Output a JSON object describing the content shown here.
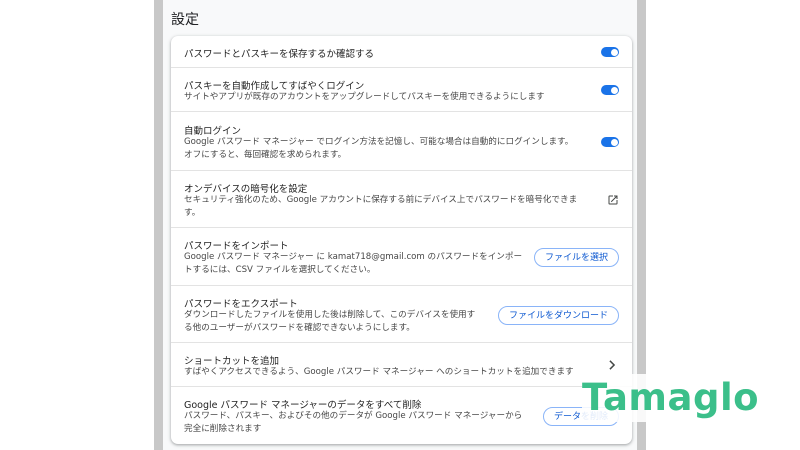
{
  "section": {
    "title": "設定"
  },
  "colors": {
    "accent": "#1a73e8",
    "brand": "#3bbf8a"
  },
  "rows": [
    {
      "title": "パスワードとパスキーを保存するか確認する",
      "control": "toggle",
      "on": true
    },
    {
      "title": "パスキーを自動作成してすばやくログイン",
      "desc": "サイトやアプリが既存のアカウントをアップグレードしてパスキーを使用できるようにします",
      "control": "toggle",
      "on": true
    },
    {
      "title": "自動ログイン",
      "desc1": "Google パスワード マネージャー でログイン方法を記憶し、可能な場合は自動的にログインします。",
      "desc2": "オフにすると、毎回確認を求められます。",
      "control": "toggle",
      "on": true
    },
    {
      "title": "オンデバイスの暗号化を設定",
      "desc1": "セキュリティ強化のため、Google アカウントに保存する前にデバイス上でパスワードを暗号化できま",
      "desc2": "す。",
      "control": "external-link-icon"
    },
    {
      "title": "パスワードをインポート",
      "desc1": "Google パスワード マネージャー に kamat718@gmail.com のパスワードをインポー",
      "desc2": "トするには、CSV ファイルを選択してください。",
      "button": "ファイルを選択"
    },
    {
      "title": "パスワードをエクスポート",
      "desc1": "ダウンロードしたファイルを使用した後は削除して、このデバイスを使用す",
      "desc2": "る他のユーザーがパスワードを確認できないようにします。",
      "button": "ファイルをダウンロード"
    },
    {
      "title": "ショートカットを追加",
      "desc": "すばやくアクセスできるよう、Google パスワード マネージャー へのショートカットを追加できます",
      "control": "chevron-right-icon"
    },
    {
      "title": "Google パスワード マネージャーのデータをすべて削除",
      "desc1": "パスワード、パスキー、およびその他のデータが Google パスワード マネージャーから",
      "desc2": "完全に削除されます",
      "button": "データを削除"
    }
  ],
  "watermark": {
    "text": "Tamaglo"
  }
}
